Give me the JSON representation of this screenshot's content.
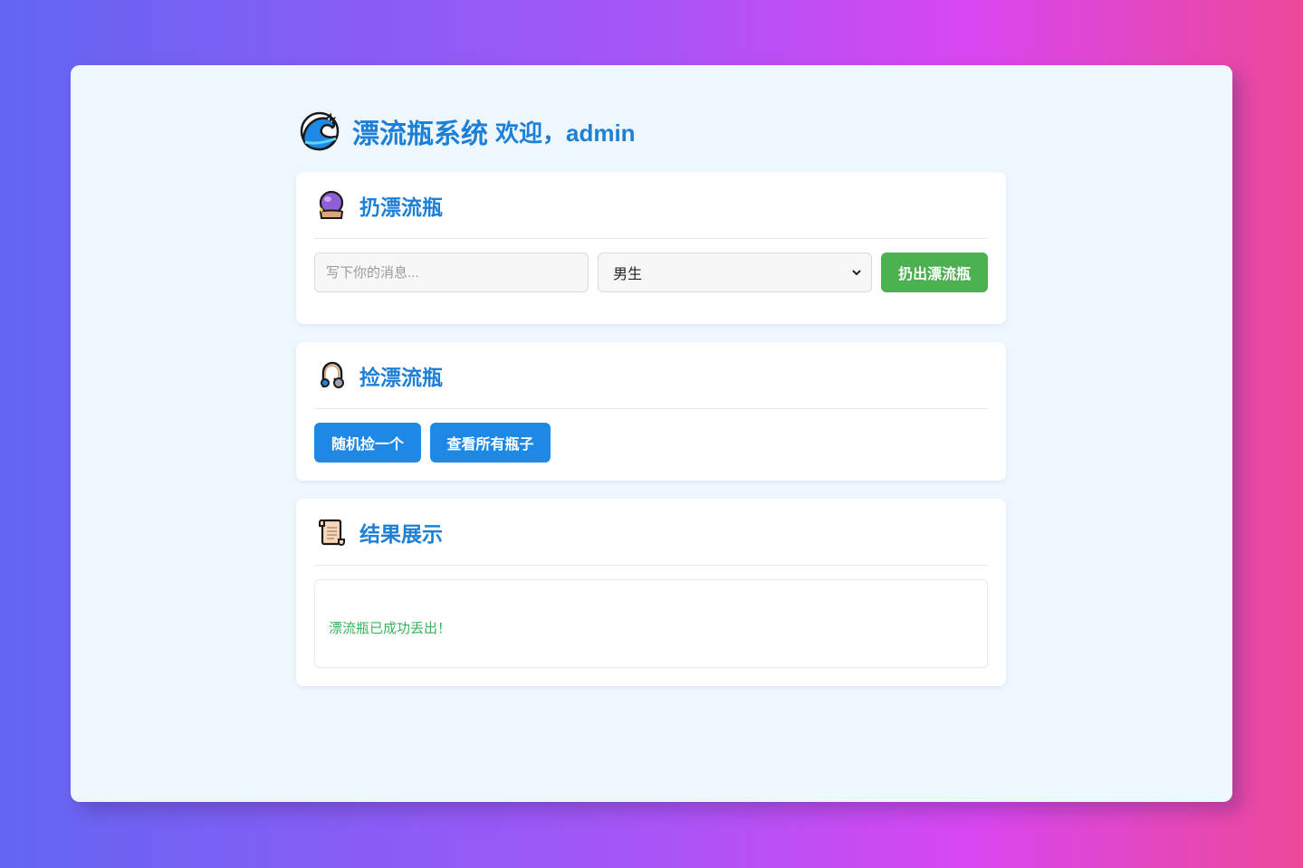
{
  "header": {
    "title": "漂流瓶系统",
    "welcome": "欢迎，admin",
    "icon": "wave-icon"
  },
  "throw_section": {
    "title": "扔漂流瓶",
    "icon": "crystal-ball-icon",
    "message_placeholder": "写下你的消息...",
    "message_value": "",
    "gender_selected": "男生",
    "throw_button": "扔出漂流瓶"
  },
  "pick_section": {
    "title": "捡漂流瓶",
    "icon": "fishing-hook-icon",
    "random_button": "随机捡一个",
    "view_all_button": "查看所有瓶子"
  },
  "result_section": {
    "title": "结果展示",
    "icon": "scroll-icon",
    "message": "漂流瓶已成功丢出！"
  },
  "colors": {
    "accent_blue": "#1e7fd6",
    "button_blue": "#1e88e5",
    "button_green": "#4caf50",
    "success_text": "#34b35a"
  }
}
